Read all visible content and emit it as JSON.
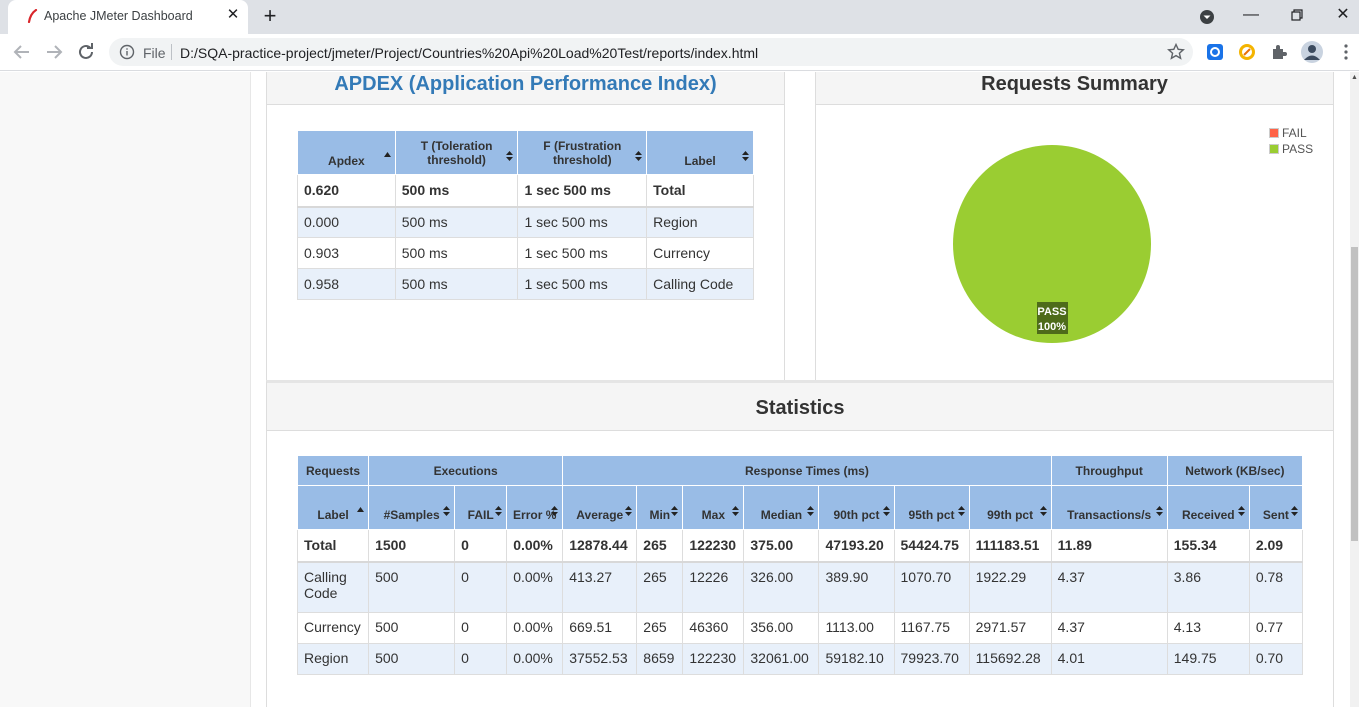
{
  "browser": {
    "tab_title": "Apache JMeter Dashboard",
    "scheme_label": "File",
    "url": "D:/SQA-practice-project/jmeter/Project/Countries%20Api%20Load%20Test/reports/index.html"
  },
  "apdex": {
    "title": "APDEX (Application Performance Index)",
    "headers": [
      "Apdex",
      "T (Toleration threshold)",
      "F (Frustration threshold)",
      "Label"
    ],
    "total": [
      "0.620",
      "500 ms",
      "1 sec 500 ms",
      "Total"
    ],
    "rows": [
      [
        "0.000",
        "500 ms",
        "1 sec 500 ms",
        "Region"
      ],
      [
        "0.903",
        "500 ms",
        "1 sec 500 ms",
        "Currency"
      ],
      [
        "0.958",
        "500 ms",
        "1 sec 500 ms",
        "Calling Code"
      ]
    ]
  },
  "summary": {
    "title": "Requests Summary",
    "legend": [
      {
        "label": "FAIL",
        "color": "#ff6347"
      },
      {
        "label": "PASS",
        "color": "#9acd32"
      }
    ],
    "pie_label": "PASS",
    "pie_percent": "100%"
  },
  "chart_data": {
    "type": "pie",
    "categories": [
      "FAIL",
      "PASS"
    ],
    "values": [
      0,
      100
    ],
    "colors": [
      "#ff6347",
      "#9acd32"
    ],
    "title": "Requests Summary",
    "legend": "top-right"
  },
  "statistics": {
    "title": "Statistics",
    "groups": [
      "Requests",
      "Executions",
      "Response Times (ms)",
      "Throughput",
      "Network (KB/sec)"
    ],
    "headers": [
      "Label",
      "#Samples",
      "FAIL",
      "Error %",
      "Average",
      "Min",
      "Max",
      "Median",
      "90th pct",
      "95th pct",
      "99th pct",
      "Transactions/s",
      "Received",
      "Sent"
    ],
    "total": [
      "Total",
      "1500",
      "0",
      "0.00%",
      "12878.44",
      "265",
      "122230",
      "375.00",
      "47193.20",
      "54424.75",
      "111183.51",
      "11.89",
      "155.34",
      "2.09"
    ],
    "rows": [
      [
        "Calling Code",
        "500",
        "0",
        "0.00%",
        "413.27",
        "265",
        "12226",
        "326.00",
        "389.90",
        "1070.70",
        "1922.29",
        "4.37",
        "3.86",
        "0.78"
      ],
      [
        "Currency",
        "500",
        "0",
        "0.00%",
        "669.51",
        "265",
        "46360",
        "356.00",
        "1113.00",
        "1167.75",
        "2971.57",
        "4.37",
        "4.13",
        "0.77"
      ],
      [
        "Region",
        "500",
        "0",
        "0.00%",
        "37552.53",
        "8659",
        "122230",
        "32061.00",
        "59182.10",
        "79923.70",
        "115692.28",
        "4.01",
        "149.75",
        "0.70"
      ]
    ]
  }
}
